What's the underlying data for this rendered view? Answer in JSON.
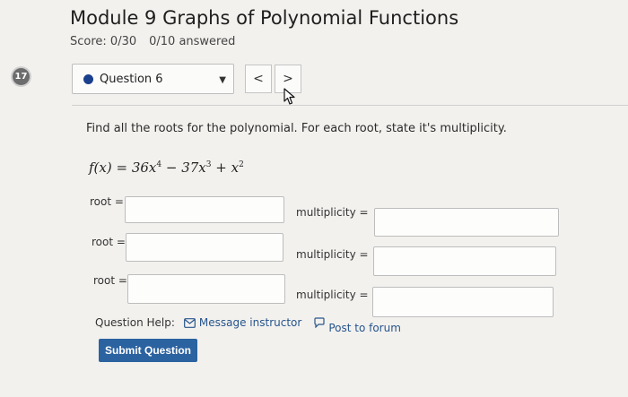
{
  "header": {
    "title": "Module 9 Graphs of Polynomial Functions",
    "score": "Score: 0/30",
    "answered": "0/10 answered"
  },
  "question_nav": {
    "number_badge": "17",
    "selected_question": "Question 6",
    "prev_label": "<",
    "next_label": ">"
  },
  "question": {
    "prompt": "Find all the roots for the polynomial. For each root, state it's multiplicity.",
    "formula": {
      "lhs": "f(x) = 36x",
      "exp1": "4",
      "t2": " − 37x",
      "exp2": "3",
      "t3": " + x",
      "exp3": "2"
    }
  },
  "answers": {
    "rows": [
      {
        "root_label": "root =",
        "root_value": "",
        "mult_label": "multiplicity =",
        "mult_value": ""
      },
      {
        "root_label": "root =",
        "root_value": "",
        "mult_label": "multiplicity =",
        "mult_value": ""
      },
      {
        "root_label": "root =",
        "root_value": "",
        "mult_label": "multiplicity =",
        "mult_value": ""
      }
    ]
  },
  "help": {
    "label": "Question Help:",
    "message_link": "Message instructor",
    "forum_link": "Post to forum"
  },
  "submit_label": "Submit Question",
  "icons": {
    "badge": "question-number-badge",
    "caret": "caret-down-icon",
    "message": "envelope-icon",
    "forum": "speech-bubble-icon",
    "cursor": "mouse-pointer-icon"
  }
}
